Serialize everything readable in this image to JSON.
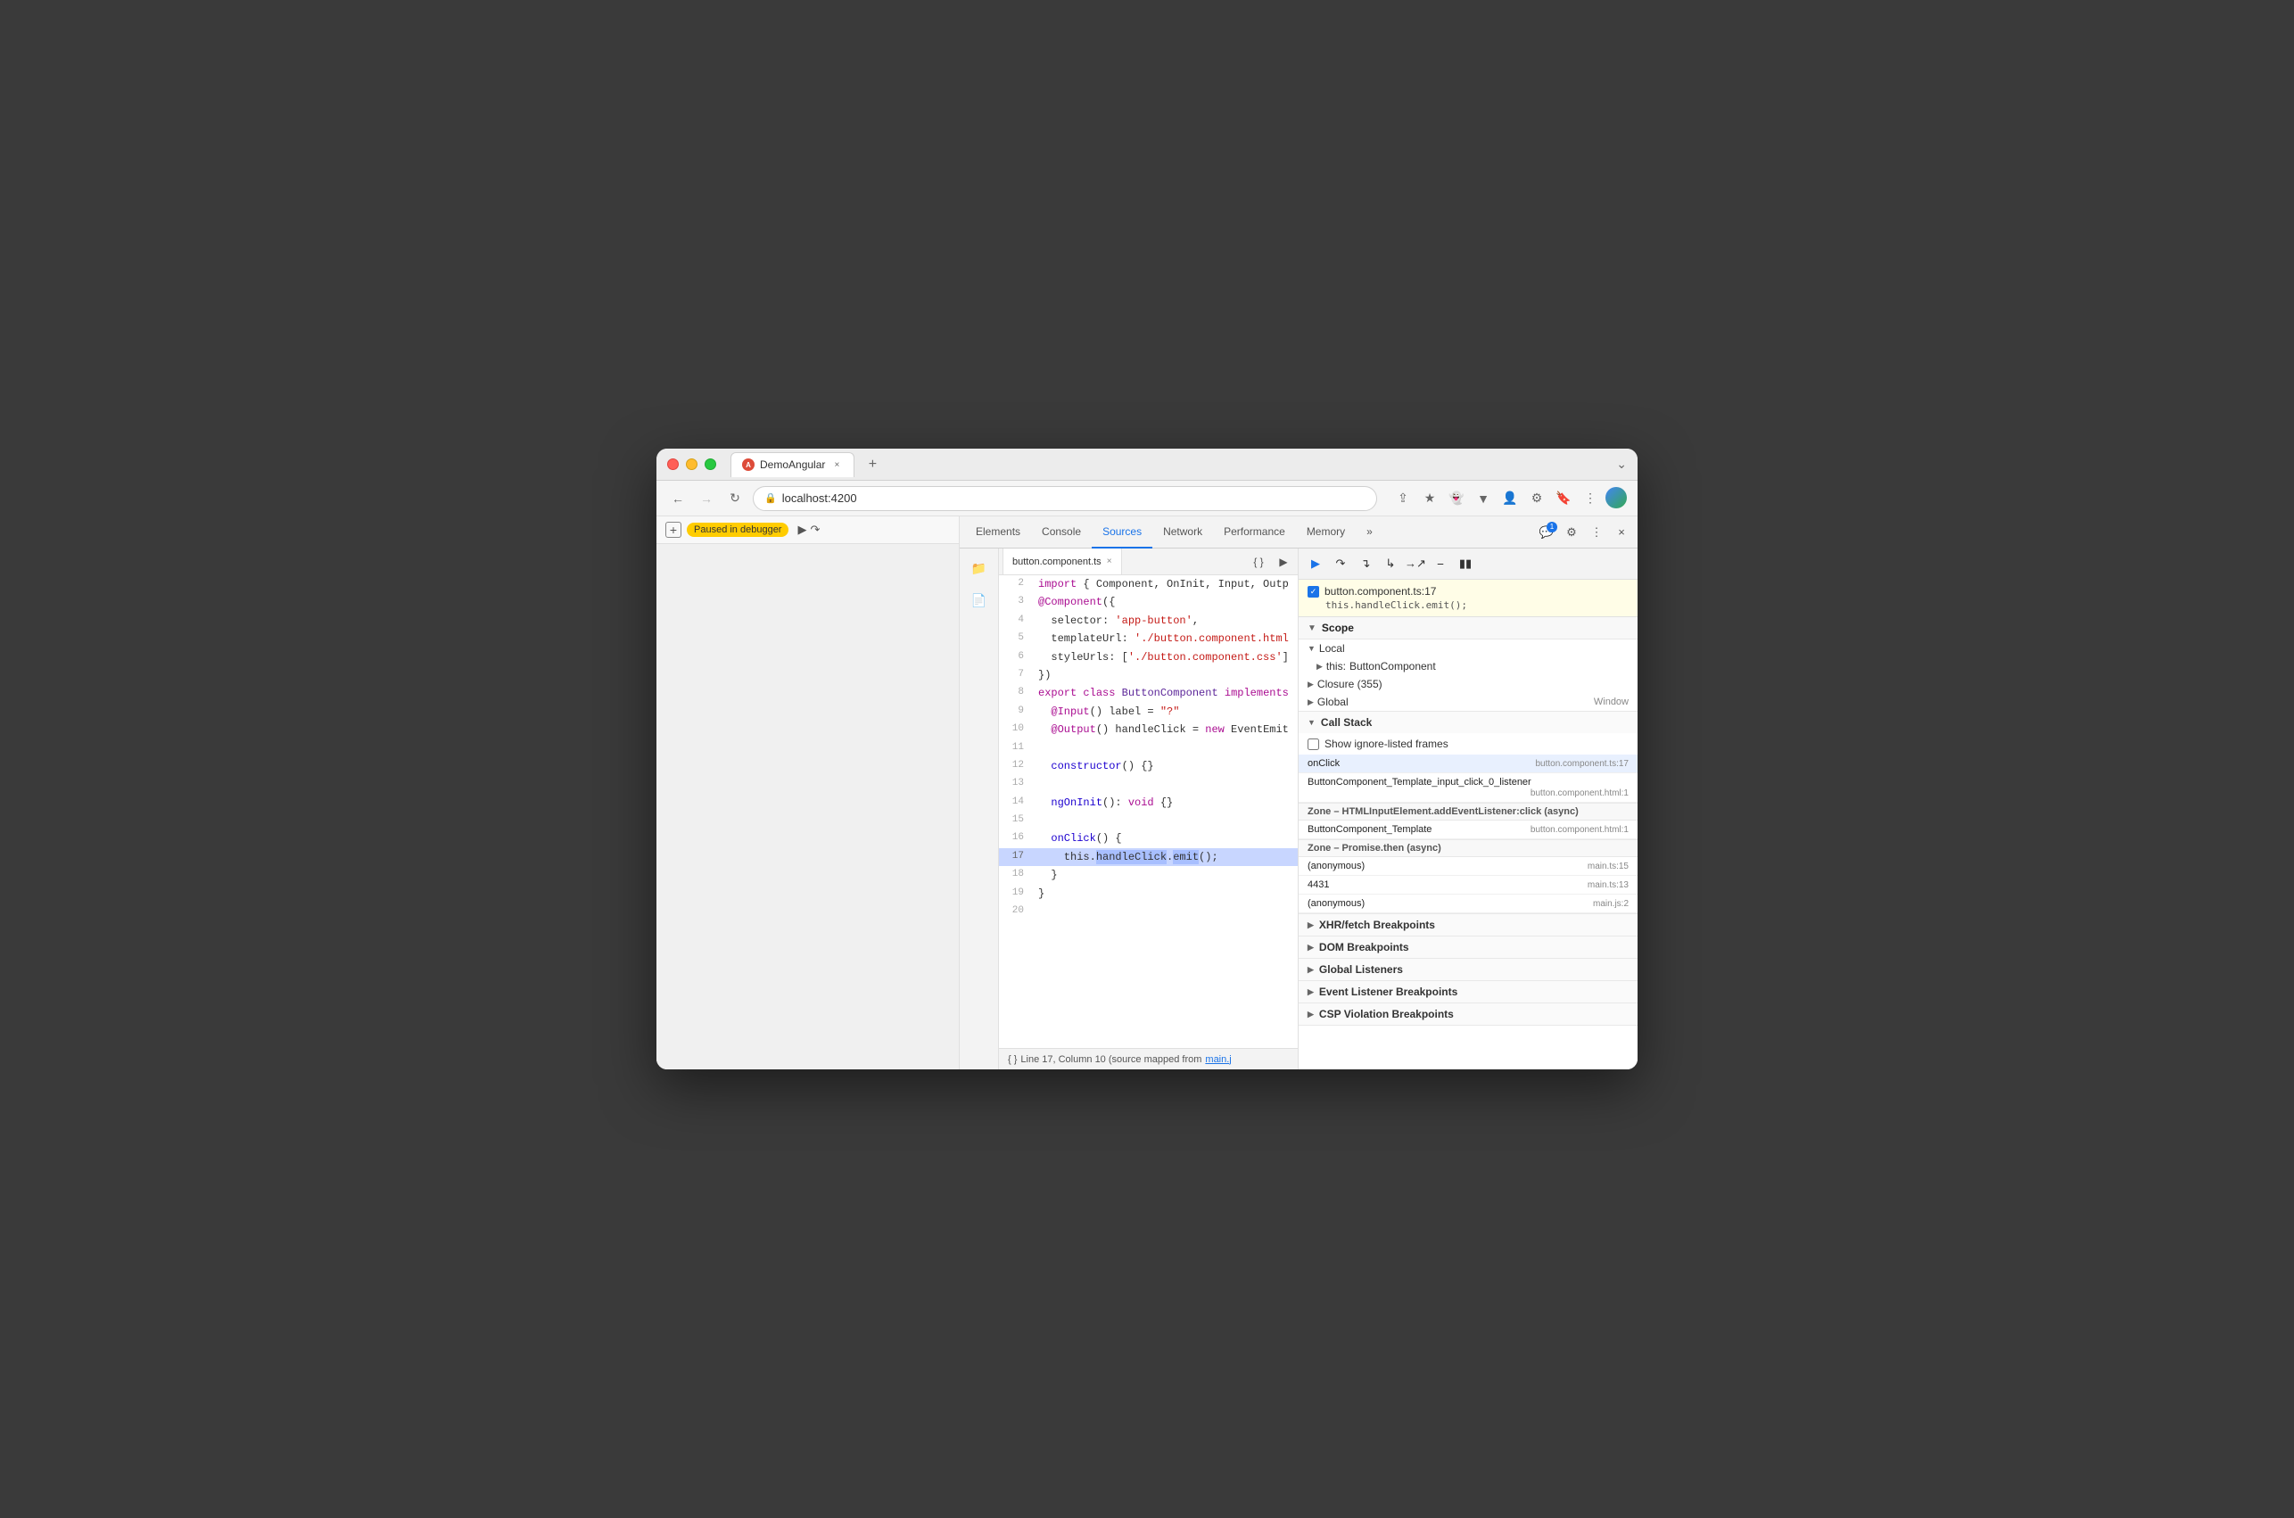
{
  "browser": {
    "title": "DemoAngular",
    "favicon": "A",
    "url": "localhost:4200",
    "tab_close_label": "×",
    "new_tab_label": "+",
    "expand_label": "⌄"
  },
  "nav": {
    "back_disabled": false,
    "forward_disabled": true,
    "refresh_label": "↻"
  },
  "address": {
    "lock_icon": "🔒",
    "url": "localhost:4200"
  },
  "devtools": {
    "tabs": [
      {
        "id": "elements",
        "label": "Elements",
        "active": false
      },
      {
        "id": "console",
        "label": "Console",
        "active": false
      },
      {
        "id": "sources",
        "label": "Sources",
        "active": true
      },
      {
        "id": "network",
        "label": "Network",
        "active": false
      },
      {
        "id": "performance",
        "label": "Performance",
        "active": false
      },
      {
        "id": "memory",
        "label": "Memory",
        "active": false
      }
    ],
    "more_label": "»",
    "console_badge": "1",
    "settings_label": "⚙",
    "more_options_label": "⋮",
    "close_label": "×"
  },
  "paused": {
    "add_label": "+",
    "status": "Paused in debugger",
    "play_label": "▶",
    "step_over_label": "↷"
  },
  "editor": {
    "filename": "button.component.ts",
    "close_label": "×",
    "format_label": "{ }",
    "breakpoint_play_label": "▶",
    "lines": [
      {
        "num": "2",
        "content": "import { Component, OnInit, Input, Outp",
        "klass": ""
      },
      {
        "num": "3",
        "content": "@Component({",
        "klass": ""
      },
      {
        "num": "4",
        "content": "  selector: 'app-button',",
        "klass": ""
      },
      {
        "num": "5",
        "content": "  templateUrl: './button.component.html",
        "klass": ""
      },
      {
        "num": "6",
        "content": "  styleUrls: ['./button.component.css']",
        "klass": ""
      },
      {
        "num": "7",
        "content": "})",
        "klass": ""
      },
      {
        "num": "8",
        "content": "export class ButtonComponent implements",
        "klass": ""
      },
      {
        "num": "9",
        "content": "  @Input() label = \"?\"",
        "klass": ""
      },
      {
        "num": "10",
        "content": "  @Output() handleClick = new EventEmit",
        "klass": ""
      },
      {
        "num": "11",
        "content": "",
        "klass": ""
      },
      {
        "num": "12",
        "content": "  constructor() {}",
        "klass": ""
      },
      {
        "num": "13",
        "content": "",
        "klass": ""
      },
      {
        "num": "14",
        "content": "  ngOnInit(): void {}",
        "klass": ""
      },
      {
        "num": "15",
        "content": "",
        "klass": ""
      },
      {
        "num": "16",
        "content": "  onClick() {",
        "klass": ""
      },
      {
        "num": "17",
        "content": "    this.handleClick.emit();",
        "klass": "current",
        "highlighted": true
      },
      {
        "num": "18",
        "content": "  }",
        "klass": ""
      },
      {
        "num": "19",
        "content": "}",
        "klass": ""
      },
      {
        "num": "20",
        "content": "",
        "klass": ""
      }
    ],
    "footer_text": "Line 17, Column 10 (source mapped from",
    "footer_link": "main.j"
  },
  "debug": {
    "toolbar_buttons": [
      {
        "id": "resume",
        "icon": "▶",
        "active": true,
        "title": "Resume"
      },
      {
        "id": "step-over",
        "icon": "↷",
        "active": false,
        "title": "Step over"
      },
      {
        "id": "step-into",
        "icon": "↓",
        "active": false,
        "title": "Step into"
      },
      {
        "id": "step-out",
        "icon": "↑",
        "active": false,
        "title": "Step out"
      },
      {
        "id": "step",
        "icon": "→",
        "active": false,
        "title": "Step"
      },
      {
        "id": "deactivate",
        "icon": "⊘",
        "active": false,
        "title": "Deactivate"
      },
      {
        "id": "pause-on-exception",
        "icon": "⏸",
        "active": false,
        "title": "Pause on exceptions"
      }
    ],
    "breakpoint": {
      "checked": true,
      "file": "button.component.ts:17",
      "code": "this.handleClick.emit();"
    },
    "scope": {
      "title": "Scope",
      "local": {
        "title": "Local",
        "items": [
          {
            "key": "▶ this:",
            "value": "ButtonComponent"
          }
        ]
      },
      "closure": {
        "title": "Closure",
        "count": "355"
      },
      "global": {
        "title": "Global",
        "value": "Window"
      }
    },
    "call_stack": {
      "title": "Call Stack",
      "show_ignore_label": "Show ignore-listed frames",
      "frames": [
        {
          "fn": "onClick",
          "file": "button.component.ts:17",
          "active": true
        },
        {
          "fn": "ButtonComponent_Template_input_click_0_listener",
          "file": "button.component.html:1",
          "active": false
        }
      ],
      "async_zones": [
        {
          "label": "Zone – HTMLInputElement.addEventListener:click (async)",
          "frames": [
            {
              "fn": "ButtonComponent_Template",
              "file": "button.component.html:1"
            }
          ]
        },
        {
          "label": "Zone – Promise.then (async)",
          "frames": [
            {
              "fn": "(anonymous)",
              "file": "main.ts:15"
            },
            {
              "fn": "4431",
              "file": "main.ts:13"
            },
            {
              "fn": "(anonymous)",
              "file": "main.js:2"
            }
          ]
        }
      ]
    },
    "breakpoints": [
      {
        "label": "XHR/fetch Breakpoints",
        "expanded": false
      },
      {
        "label": "DOM Breakpoints",
        "expanded": false
      },
      {
        "label": "Global Listeners",
        "expanded": false
      },
      {
        "label": "Event Listener Breakpoints",
        "expanded": false
      },
      {
        "label": "CSP Violation Breakpoints",
        "expanded": false
      }
    ]
  }
}
